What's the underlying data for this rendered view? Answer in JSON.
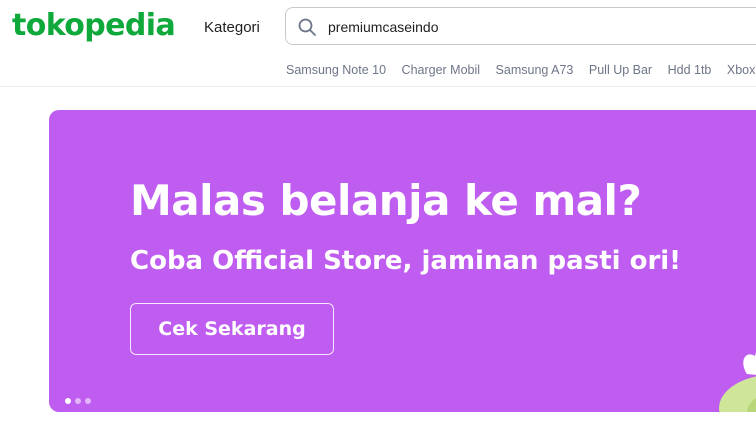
{
  "header": {
    "logo_text": "tokopedia",
    "kategori_label": "Kategori",
    "search": {
      "value": "premiumcaseindo"
    },
    "suggestions": [
      "Samsung Note 10",
      "Charger Mobil",
      "Samsung A73",
      "Pull Up Bar",
      "Hdd 1tb",
      "Xbox S"
    ]
  },
  "banner": {
    "headline": "Malas belanja ke mal?",
    "subheadline": "Coba Official Store, jaminan pasti ori!",
    "cta_label": "Cek Sekarang",
    "slides_total": 3,
    "active_slide": 1
  },
  "colors": {
    "brand_green": "#0fa83a",
    "banner_purple": "#c05df1",
    "text_dark": "#212121",
    "text_muted": "#6d7588"
  }
}
